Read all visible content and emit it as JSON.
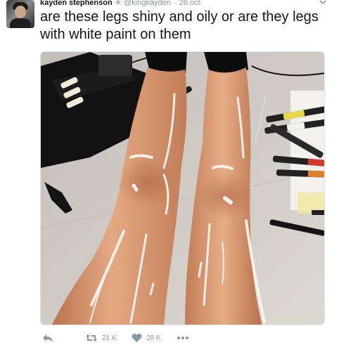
{
  "tweet": {
    "display_name": "kayden stephenson",
    "handle": "@kingkayden",
    "separator": "·",
    "date": "26 oct.",
    "text": "are these legs shiny and oily or are they legs with white paint on them",
    "retweet_count": "21 K",
    "like_count": "28 K"
  },
  "colors": {
    "text": "#14171a",
    "muted": "#8899a6",
    "skin": "#d99a72",
    "floor": "#cfcac3"
  },
  "icons": {
    "reply": "reply-icon",
    "retweet": "retweet-icon",
    "like": "heart-icon",
    "more": "more-dots-icon",
    "caret": "chevron-down-icon"
  }
}
